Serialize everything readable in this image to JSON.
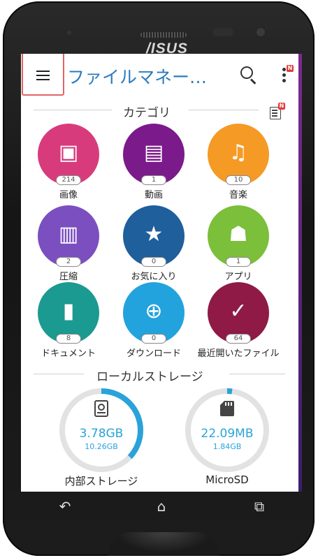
{
  "device": {
    "brand": "/ISUS"
  },
  "appbar": {
    "title": "ファイルマネー…",
    "badge": "N"
  },
  "categories_section": {
    "title": "カテゴリ",
    "edit_badge": "N"
  },
  "categories": [
    {
      "label": "画像",
      "count": "214",
      "icon": "image-icon",
      "color": "#d83b7c",
      "glyph": "▣"
    },
    {
      "label": "動画",
      "count": "1",
      "icon": "video-icon",
      "color": "#7b1a8a",
      "glyph": "▤"
    },
    {
      "label": "音楽",
      "count": "10",
      "icon": "music-icon",
      "color": "#f59a24",
      "glyph": "♫"
    },
    {
      "label": "圧縮",
      "count": "2",
      "icon": "zip-icon",
      "color": "#7b4fbf",
      "glyph": "▥"
    },
    {
      "label": "お気に入り",
      "count": "0",
      "icon": "star-icon",
      "color": "#1e5f9c",
      "glyph": "★"
    },
    {
      "label": "アプリ",
      "count": "1",
      "icon": "android-icon",
      "color": "#7bbf3a",
      "glyph": "☗"
    },
    {
      "label": "ドキュメント",
      "count": "8",
      "icon": "document-icon",
      "color": "#1a9a90",
      "glyph": "▮"
    },
    {
      "label": "ダウンロード",
      "count": "0",
      "icon": "download-icon",
      "color": "#22a3dd",
      "glyph": "⊕"
    },
    {
      "label": "最近開いたファイル",
      "count": "64",
      "icon": "recent-check-icon",
      "color": "#8e1a45",
      "glyph": "✓"
    }
  ],
  "storage_section": {
    "title": "ローカルストレージ"
  },
  "storage": [
    {
      "name": "内部ストレージ",
      "used": "3.78GB",
      "total": "10.26GB",
      "icon": "hard-drive-icon",
      "fraction": 0.37
    },
    {
      "name": "MicroSD",
      "used": "22.09MB",
      "total": "1.84GB",
      "icon": "sd-card-icon",
      "fraction": 0.012
    }
  ],
  "colors": {
    "accent": "#2b7bbd",
    "ring_used": "#29a3d9",
    "ring_track": "#e2e2e2",
    "highlight": "#e26565"
  },
  "nav": {
    "back": "↶",
    "home": "⌂",
    "recents": "⧉"
  }
}
